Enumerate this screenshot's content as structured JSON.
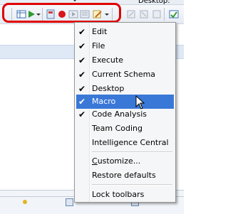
{
  "window": {
    "top_text": "Desktop: SQL"
  },
  "toolbar": {
    "icons": [
      "grid-icon",
      "run-icon",
      "properties-icon",
      "record-macro-icon",
      "play-macro-icon",
      "macro-list-icon",
      "edit-macro-icon",
      "lock-icon",
      "unlock-icon",
      "grid-view-icon",
      "spellcheck-icon"
    ]
  },
  "context_menu": {
    "items": [
      {
        "label": "Edit",
        "checked": true
      },
      {
        "label": "File",
        "checked": true
      },
      {
        "label": "Execute",
        "checked": true
      },
      {
        "label": "Current Schema",
        "checked": true
      },
      {
        "label": "Desktop",
        "checked": true
      },
      {
        "label": "Macro",
        "checked": true,
        "selected": true
      },
      {
        "label": "Code Analysis",
        "checked": true
      },
      {
        "label": "Team Coding",
        "checked": false
      },
      {
        "label": "Intelligence Central",
        "checked": false
      },
      {
        "label": "Customize...",
        "checked": false,
        "underline": "C"
      },
      {
        "label": "Restore defaults",
        "checked": false
      },
      {
        "label": "Lock toolbars",
        "checked": false
      }
    ],
    "check_glyph": "✔"
  },
  "colors": {
    "highlight": "#e00000",
    "selection": "#3a78d8"
  }
}
